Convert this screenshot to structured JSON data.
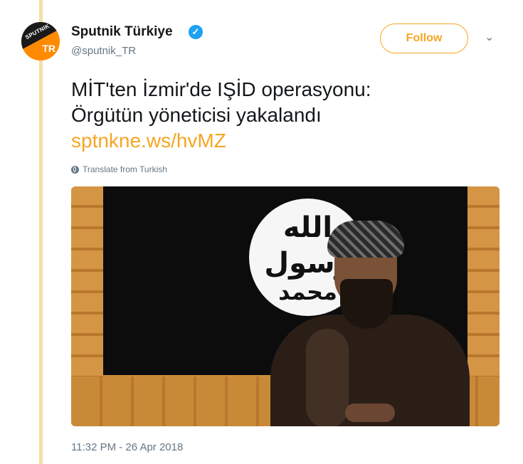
{
  "account": {
    "avatar_text_top": "SPUTNIK",
    "avatar_text_bottom": "TR",
    "display_name": "Sputnik Türkiye",
    "handle": "@sputnik_TR",
    "verified_icon": "verified-badge-icon"
  },
  "actions": {
    "follow_label": "Follow",
    "menu_icon": "chevron-down-icon"
  },
  "tweet": {
    "text_line1": "MİT'ten İzmir'de IŞİD operasyonu:",
    "text_line2": "Örgütün yöneticisi yakalandı",
    "link": "sptnkne.ws/hvMZ",
    "translate_label": "Translate from Turkish",
    "timestamp": "11:32 PM - 26 Apr 2018"
  },
  "media": {
    "flag_text_line1": "الله",
    "flag_text_line2": "رسول",
    "flag_text_line3": "محمد"
  },
  "colors": {
    "accent": "#f5a623",
    "thread_line": "#f5dfa6",
    "verified": "#1da1f2",
    "secondary_text": "#657786"
  }
}
